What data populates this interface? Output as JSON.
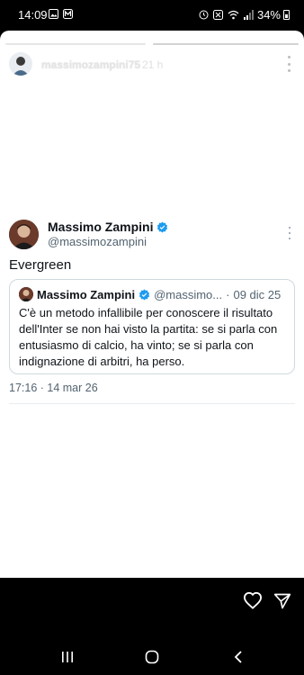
{
  "status_bar": {
    "time": "14:09",
    "battery": "34%",
    "left_icons": [
      "image-icon",
      "m-app-icon"
    ],
    "right_icons": [
      "alarm-icon",
      "nfc-icon",
      "wifi-icon",
      "signal-icon"
    ]
  },
  "story": {
    "username": "massimozampini75",
    "age": "21 h",
    "progress_segments": 2
  },
  "tweet": {
    "author_name": "Massimo Zampini",
    "author_handle": "@massimozampini",
    "text": "Evergreen",
    "timestamp": "17:16 · 14 mar 26",
    "quote": {
      "author_name": "Massimo Zampini",
      "author_handle": "@massimo...",
      "separator": "·",
      "date": "09 dic 25",
      "text": "C'è un metodo infallibile per conoscere il risultato dell'Inter se non hai visto la partita: se si parla con entusiasmo di calcio, ha vinto; se si parla con indignazione di arbitri, ha perso."
    }
  },
  "colors": {
    "verified_blue": "#1d9bf0",
    "text_primary": "#0f1419",
    "text_secondary": "#536471"
  }
}
